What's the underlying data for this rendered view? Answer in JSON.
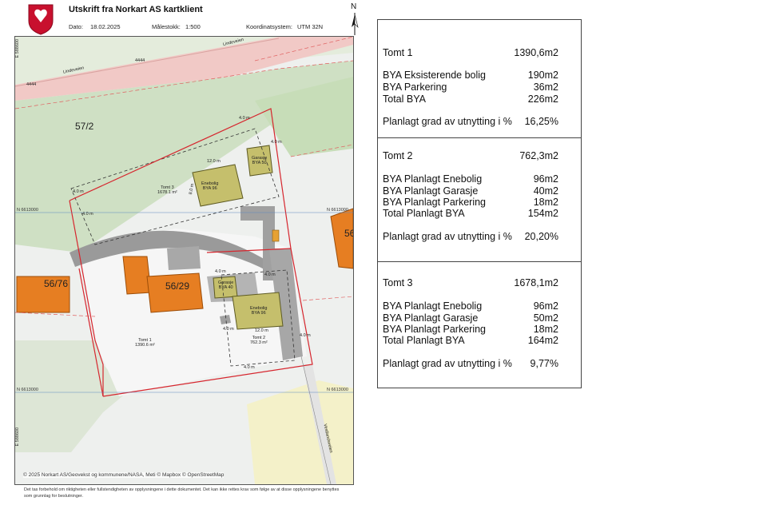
{
  "header": {
    "title": "Utskrift fra Norkart AS kartklient",
    "date_label": "Dato:",
    "date_value": "18.02.2025",
    "scale_label": "Målestokk:",
    "scale_value": "1:500",
    "crs_label": "Koordinatsystem:",
    "crs_value": "UTM 32N",
    "north": "N"
  },
  "map": {
    "parcels": [
      "57/2",
      "56/76",
      "56/29"
    ],
    "house_number_partial": "56",
    "roads": [
      "Lindeveien",
      "Lindeveien"
    ],
    "road_numbers": [
      "4444",
      "4444"
    ],
    "lower_road": "Vestlandsveien",
    "coord_labels": [
      "N 6613000",
      "N 6613000",
      "N 6613000",
      "N 6613000"
    ],
    "side_coords": [
      "E 588600",
      "E 588600"
    ],
    "plots": [
      {
        "name": "Tomt 1",
        "area": "1390.6 m²"
      },
      {
        "name": "Tomt 2",
        "area": "762.3 m²"
      },
      {
        "name": "Tomt 3",
        "area": "1678.1 m²"
      }
    ],
    "buildings": [
      {
        "type": "Enebolig",
        "bya": "BYA 96"
      },
      {
        "type": "Garasje",
        "bya": "BYA 50"
      },
      {
        "type": "Garasje",
        "bya": "BYA 40"
      },
      {
        "type": "Enebolig",
        "bya": "BYA 96"
      }
    ],
    "dims": [
      "4.0 m",
      "12.0 m",
      "4.0 m",
      "8.0 m",
      "4.0 m",
      "4.0 m",
      "12.0 m",
      "4.0 m",
      "4.0 m",
      "4.0 m",
      "4.0 m",
      "4.0 m"
    ],
    "attribution": "© 2025 Norkart AS/Geovekst og kommunene/NASA, Meti © Mapbox © OpenStreetMap"
  },
  "footer": "Det tas forbehold om riktigheten eller fullstendigheten av opplysningene i dette dokumentet. Det kan ikke rettes krav som følge av at disse opplysningene benyttes som grunnlag for beslutninger.",
  "table": {
    "sections": [
      {
        "title": "Tomt 1",
        "title_value": "1390,6m2",
        "rows": [
          {
            "label": "BYA Eksisterende bolig",
            "value": "190m2"
          },
          {
            "label": "BYA Parkering",
            "value": "36m2"
          },
          {
            "label": "Total BYA",
            "value": "226m2"
          }
        ],
        "utnytting_label": "Planlagt grad av utnytting i %",
        "utnytting_value": "16,25%"
      },
      {
        "title": "Tomt  2",
        "title_value": "762,3m2",
        "rows": [
          {
            "label": "BYA Planlagt Enebolig",
            "value": "96m2"
          },
          {
            "label": "BYA Planlagt Garasje",
            "value": "40m2"
          },
          {
            "label": "BYA Planlagt Parkering",
            "value": "18m2"
          },
          {
            "label": "Total Planlagt BYA",
            "value": "154m2"
          }
        ],
        "utnytting_label": "Planlagt grad av utnytting i %",
        "utnytting_value": "20,20%"
      },
      {
        "title": "Tomt  3",
        "title_value": "1678,1m2",
        "rows": [
          {
            "label": "BYA Planlagt Enebolig",
            "value": "96m2"
          },
          {
            "label": "BYA Planlagt Garasje",
            "value": "50m2"
          },
          {
            "label": "BYA Planlagt Parkering",
            "value": "18m2"
          },
          {
            "label": "Total Planlagt BYA",
            "value": "164m2"
          }
        ],
        "utnytting_label": "Planlagt grad av utnytting i %",
        "utnytting_value": "9,77%"
      }
    ]
  }
}
